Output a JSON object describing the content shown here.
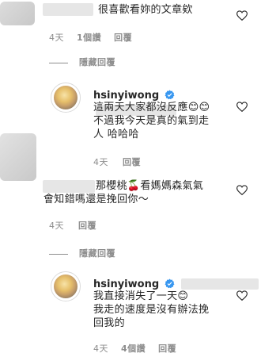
{
  "comment1": {
    "text": "很喜歡看妳的文章欸",
    "time": "4天",
    "likes": "1個讚",
    "reply": "回覆",
    "hide_replies": "隱藏回覆"
  },
  "reply1": {
    "username": "hsinyiwong",
    "text_line1": "這兩天大家都沒反應😊😊",
    "text_line2": "不過我今天是真的氣到走",
    "text_line3": "人 哈哈哈",
    "time": "4天",
    "reply": "回覆"
  },
  "comment2": {
    "text_line1": "那櫻桃🍒看媽媽森氣氣",
    "text_line2": "會知錯嗎還是挽回你～",
    "time": "4天",
    "reply": "回覆",
    "hide_replies": "隱藏回覆"
  },
  "reply2": {
    "username": "hsinyiwong",
    "text_line1": "我直接消失了一天😊",
    "text_line2": "我走的速度是沒有辦法挽",
    "text_line3": "回我的",
    "time": "4天",
    "likes": "4個讚",
    "reply": "回覆"
  },
  "icons": {
    "heart": "heart-icon",
    "verified": "verified-badge-icon"
  },
  "colors": {
    "text": "#262626",
    "meta": "#8e8e8e",
    "verified": "#3897f0"
  }
}
